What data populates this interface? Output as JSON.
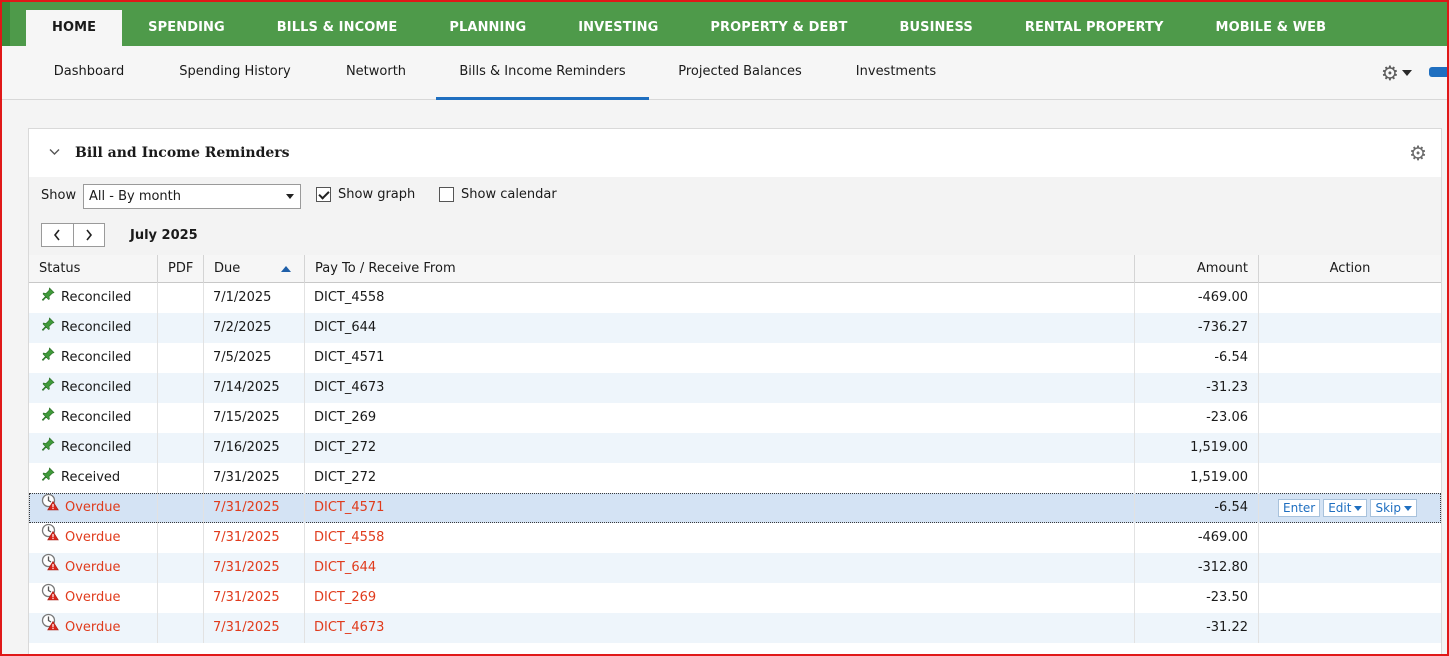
{
  "top_tabs": [
    "HOME",
    "SPENDING",
    "BILLS & INCOME",
    "PLANNING",
    "INVESTING",
    "PROPERTY & DEBT",
    "BUSINESS",
    "RENTAL PROPERTY",
    "MOBILE & WEB"
  ],
  "sub_tabs": [
    "Dashboard",
    "Spending History",
    "Networth",
    "Bills & Income Reminders",
    "Projected Balances",
    "Investments"
  ],
  "panel": {
    "title": "Bill and Income Reminders",
    "show_label": "Show",
    "show_value": "All - By month",
    "show_graph_label": "Show graph",
    "show_graph_checked": true,
    "show_calendar_label": "Show calendar",
    "show_calendar_checked": false,
    "month": "July 2025"
  },
  "table": {
    "columns": [
      "Status",
      "PDF",
      "Due",
      "Pay To / Receive From",
      "Amount",
      "Action"
    ],
    "sorted_column": "Due",
    "sort_direction": "ascending",
    "actions": [
      "Enter",
      "Edit",
      "Skip"
    ],
    "rows": [
      {
        "status": "Reconciled",
        "pdf": "",
        "due": "7/1/2025",
        "payee": "DICT_4558",
        "amount": "-469.00",
        "state": "paid"
      },
      {
        "status": "Reconciled",
        "pdf": "",
        "due": "7/2/2025",
        "payee": "DICT_644",
        "amount": "-736.27",
        "state": "paid"
      },
      {
        "status": "Reconciled",
        "pdf": "",
        "due": "7/5/2025",
        "payee": "DICT_4571",
        "amount": "-6.54",
        "state": "paid"
      },
      {
        "status": "Reconciled",
        "pdf": "",
        "due": "7/14/2025",
        "payee": "DICT_4673",
        "amount": "-31.23",
        "state": "paid"
      },
      {
        "status": "Reconciled",
        "pdf": "",
        "due": "7/15/2025",
        "payee": "DICT_269",
        "amount": "-23.06",
        "state": "paid"
      },
      {
        "status": "Reconciled",
        "pdf": "",
        "due": "7/16/2025",
        "payee": "DICT_272",
        "amount": "1,519.00",
        "state": "paid"
      },
      {
        "status": "Received",
        "pdf": "",
        "due": "7/31/2025",
        "payee": "DICT_272",
        "amount": "1,519.00",
        "state": "paid"
      },
      {
        "status": "Overdue",
        "pdf": "",
        "due": "7/31/2025",
        "payee": "DICT_4571",
        "amount": "-6.54",
        "state": "overdue",
        "selected": true
      },
      {
        "status": "Overdue",
        "pdf": "",
        "due": "7/31/2025",
        "payee": "DICT_4558",
        "amount": "-469.00",
        "state": "overdue"
      },
      {
        "status": "Overdue",
        "pdf": "",
        "due": "7/31/2025",
        "payee": "DICT_644",
        "amount": "-312.80",
        "state": "overdue"
      },
      {
        "status": "Overdue",
        "pdf": "",
        "due": "7/31/2025",
        "payee": "DICT_269",
        "amount": "-23.50",
        "state": "overdue"
      },
      {
        "status": "Overdue",
        "pdf": "",
        "due": "7/31/2025",
        "payee": "DICT_4673",
        "amount": "-31.22",
        "state": "overdue"
      }
    ]
  },
  "icons": {
    "paid": "green-pin-icon",
    "overdue": "overdue-alert-icon",
    "settings": "gear-icon"
  },
  "colors": {
    "nav_green": "#4e9a4a",
    "accent_blue": "#1f6fc0",
    "overdue_red": "#e03b1c",
    "selected_row": "#d4e3f4",
    "alt_row": "#eef5fb"
  }
}
